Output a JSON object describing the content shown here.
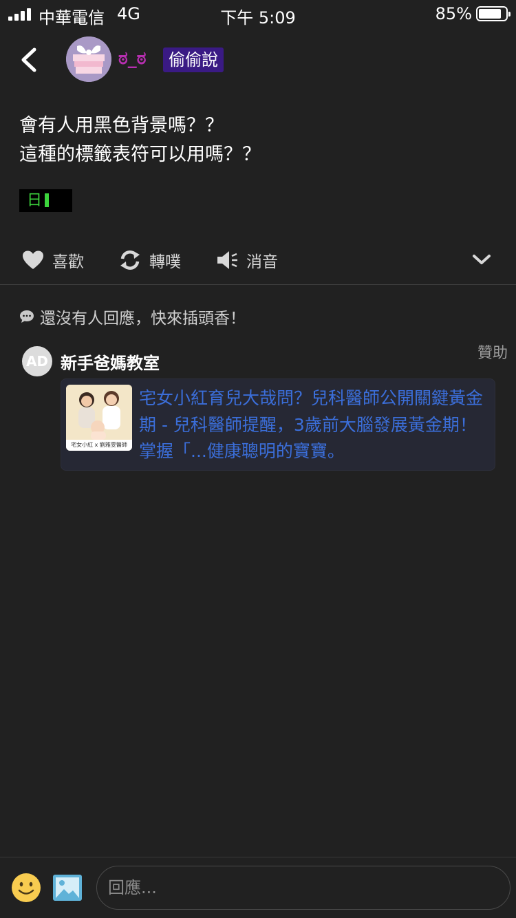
{
  "status_bar": {
    "carrier": "中華電信",
    "network": "4G",
    "time": "下午 5:09",
    "battery": "85%",
    "battery_level": 0.85
  },
  "header": {
    "username": "ಠ_ಠ",
    "board": "偷偷說"
  },
  "post": {
    "lines": [
      "會有人用黑色背景嗎？？",
      "這種的標籤表符可以用嗎？？"
    ],
    "tag_text": "日"
  },
  "actions": {
    "like": "喜歡",
    "repost": "轉噗",
    "mute": "消音"
  },
  "responses": {
    "empty_text": "還沒有人回應，快來插頭香！"
  },
  "ad": {
    "avatar_text": "AD",
    "advertiser": "新手爸媽教室",
    "sponsored_label": "贊助",
    "thumb_caption": "宅女小紅 x 劉雅雯醫師",
    "link_text": "宅女小紅育兒大哉問？兒科醫師公開關鍵黃金期 - 兒科醫師提醒，3歲前大腦發展黃金期！掌握「...健康聰明的寶寶。"
  },
  "reply_bar": {
    "placeholder": "回應..."
  },
  "colors": {
    "background": "#212121",
    "username": "#b72fb0",
    "badge": "#3a1a84",
    "link": "#3b6ed9",
    "tag_green": "#3cd43c"
  },
  "icons": [
    "signal-icon",
    "battery-icon",
    "back-chevron-icon",
    "heart-icon",
    "repost-icon",
    "speaker-mute-icon",
    "chevron-down-icon",
    "chat-bubble-icon",
    "emoji-icon",
    "image-icon"
  ]
}
